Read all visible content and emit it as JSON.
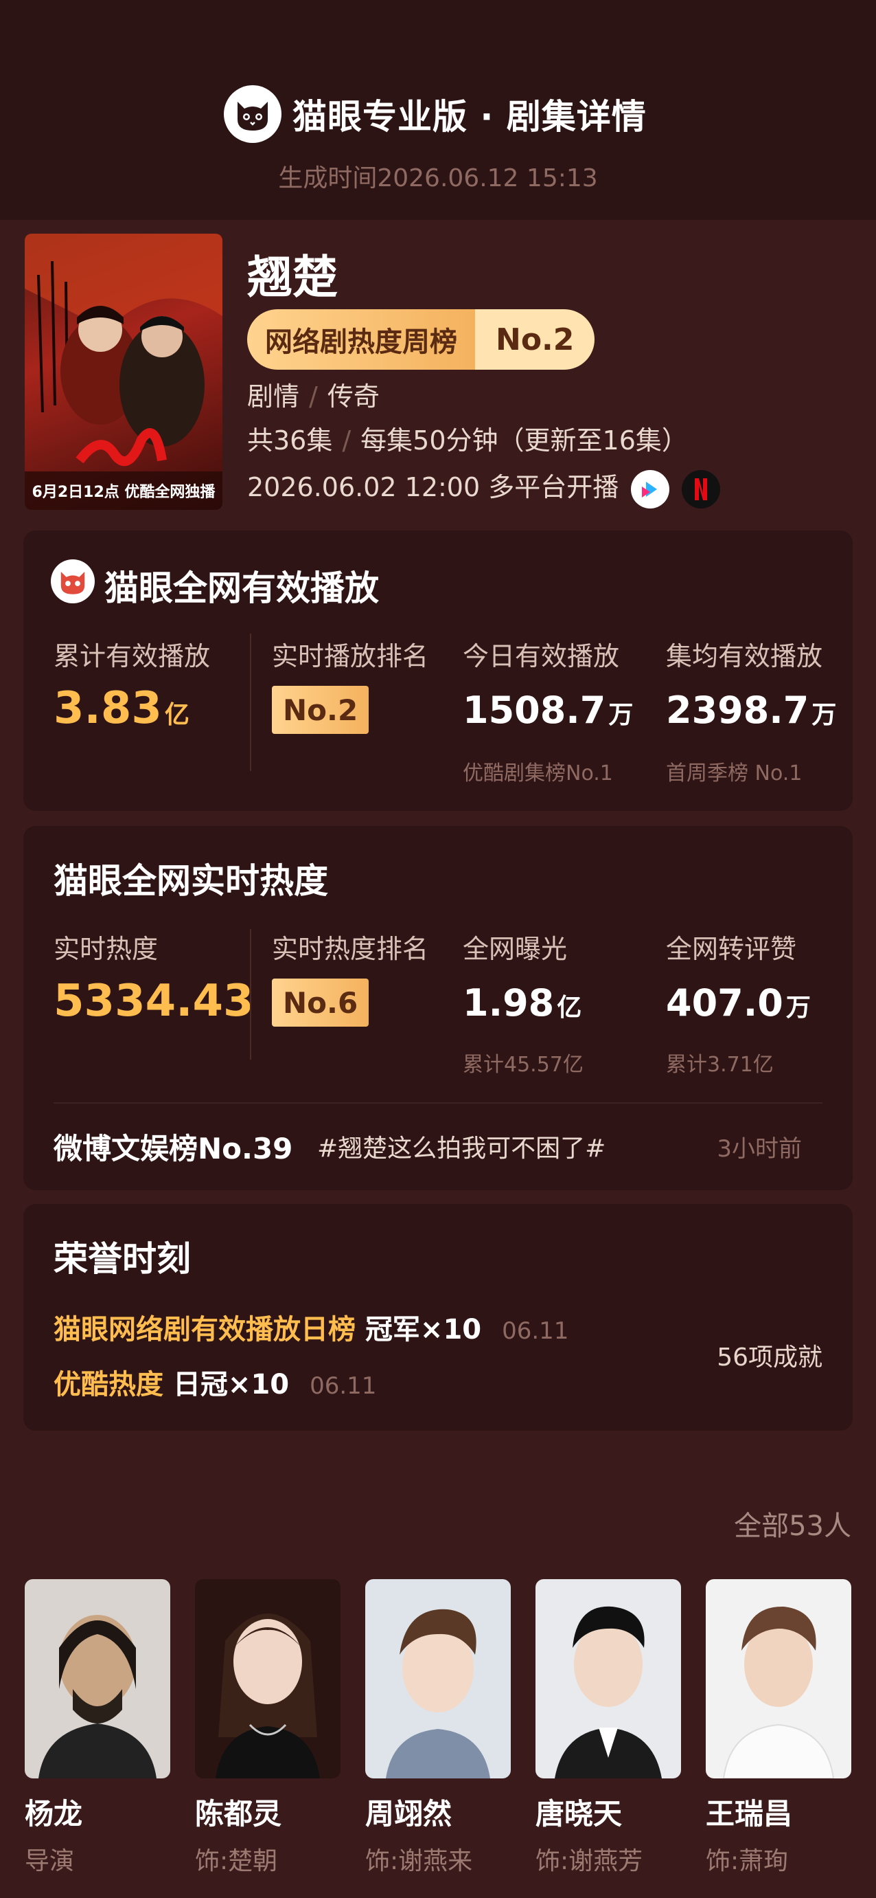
{
  "header": {
    "app_title": "猫眼专业版 · 剧集详情",
    "generated_time": "生成时间2026.06.12 15:13"
  },
  "show": {
    "title": "翘楚",
    "poster_caption": "6月2日12点 优酷全网独播",
    "badge_label": "网络剧热度周榜",
    "badge_rank": "No.2",
    "genres": [
      "剧情",
      "传奇"
    ],
    "episodes": "共36集",
    "duration": "每集50分钟（更新至16集）",
    "premiere": "2026.06.02 12:00 多平台开播",
    "platforms": [
      "youku-icon",
      "netflix-icon"
    ]
  },
  "playback": {
    "title": "猫眼全网有效播放",
    "cumulative_label": "累计有效播放",
    "cumulative_value": "3.83",
    "cumulative_unit": "亿",
    "rank_label": "实时播放排名",
    "rank_value": "No.2",
    "today_label": "今日有效播放",
    "today_value": "1508.7",
    "today_unit": "万",
    "today_sub": "优酷剧集榜No.1",
    "avg_label": "集均有效播放",
    "avg_value": "2398.7",
    "avg_unit": "万",
    "avg_sub": "首周季榜 No.1"
  },
  "heat": {
    "title": "猫眼全网实时热度",
    "realtime_label": "实时热度",
    "realtime_value": "5334.43",
    "rank_label": "实时热度排名",
    "rank_value": "No.6",
    "exposure_label": "全网曝光",
    "exposure_value": "1.98",
    "exposure_unit": "亿",
    "exposure_sub": "累计45.57亿",
    "engage_label": "全网转评赞",
    "engage_value": "407.0",
    "engage_unit": "万",
    "engage_sub": "累计3.71亿",
    "weibo_rank": "微博文娱榜No.39",
    "weibo_topic": "#翘楚这么拍我可不困了#",
    "weibo_time": "3小时前"
  },
  "honors": {
    "title": "荣誉时刻",
    "items": [
      {
        "prefix": "猫眼网络剧有效播放日榜",
        "highlight": "冠军×10",
        "date": "06.11"
      },
      {
        "prefix": "优酷热度",
        "highlight": "日冠×10",
        "date": "06.11"
      }
    ],
    "count": "56项成就"
  },
  "cast": {
    "all_label": "全部53人",
    "members": [
      {
        "name": "杨龙",
        "role": "导演"
      },
      {
        "name": "陈都灵",
        "role": "饰:楚朝"
      },
      {
        "name": "周翊然",
        "role": "饰:谢燕来"
      },
      {
        "name": "唐晓天",
        "role": "饰:谢燕芳"
      },
      {
        "name": "王瑞昌",
        "role": "饰:萧珣"
      }
    ]
  },
  "colors": {
    "background": "#3a1a1a",
    "card": "#2e1414",
    "accent_gold": "#ffbd4f"
  }
}
